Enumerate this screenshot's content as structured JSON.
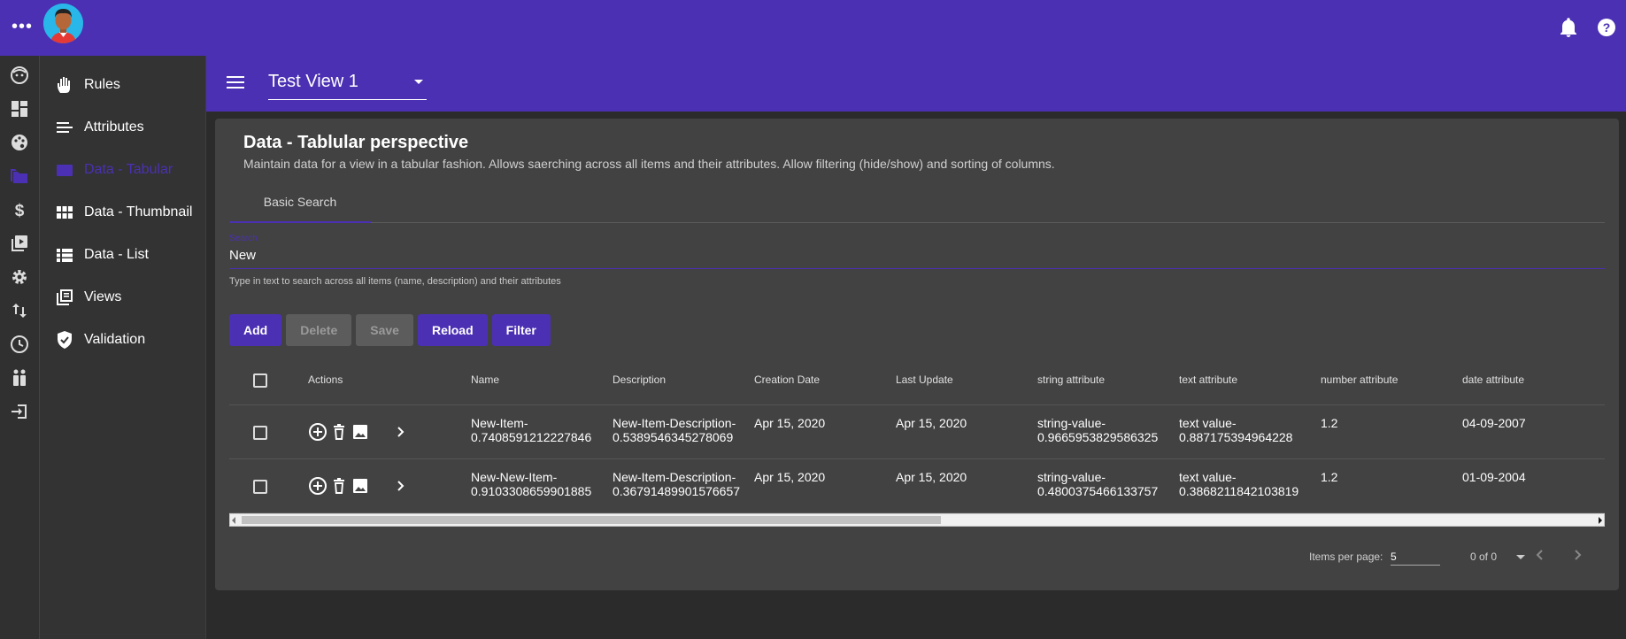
{
  "sidebar": {
    "items": [
      {
        "label": "Rules",
        "icon": "hand-icon"
      },
      {
        "label": "Attributes",
        "icon": "list-lines-icon"
      },
      {
        "label": "Data - Tabular",
        "icon": "table-icon",
        "active": true
      },
      {
        "label": "Data - Thumbnail",
        "icon": "grid-icon"
      },
      {
        "label": "Data - List",
        "icon": "list-icon"
      },
      {
        "label": "Views",
        "icon": "library-icon"
      },
      {
        "label": "Validation",
        "icon": "shield-check-icon"
      }
    ]
  },
  "view": {
    "selected": "Test View 1"
  },
  "card": {
    "title": "Data - Tablular perspective",
    "subtitle": "Maintain data for a view in a tabular fashion. Allows saerching across all items and their attributes. Allow filtering (hide/show) and sorting of columns."
  },
  "tabs": [
    "Basic Search"
  ],
  "search": {
    "label": "Search",
    "value": "New",
    "hint": "Type in text to search across all items (name, description) and their attributes"
  },
  "buttons": {
    "add": "Add",
    "delete": "Delete",
    "save": "Save",
    "reload": "Reload",
    "filter": "Filter"
  },
  "table": {
    "columns": {
      "actions": "Actions",
      "name": "Name",
      "description": "Description",
      "creation": "Creation Date",
      "update": "Last Update",
      "string_attr": "string attribute",
      "text_attr": "text attribute",
      "number_attr": "number attribute",
      "date_attr": "date attribute"
    },
    "rows": [
      {
        "name": [
          "New-Item-",
          "0.7408591212227846"
        ],
        "description": [
          "New-Item-Description-",
          "0.5389546345278069"
        ],
        "creation": "Apr 15, 2020",
        "update": "Apr 15, 2020",
        "string_attr": [
          "string-value-",
          "0.9665953829586325"
        ],
        "text_attr": [
          "text value-",
          "0.887175394964228"
        ],
        "number_attr": "1.2",
        "date_attr": "04-09-2007"
      },
      {
        "name": [
          "New-New-Item-",
          "0.9103308659901885"
        ],
        "description": [
          "New-Item-Description-",
          "0.36791489901576657"
        ],
        "creation": "Apr 15, 2020",
        "update": "Apr 15, 2020",
        "string_attr": [
          "string-value-",
          "0.4800375466133757"
        ],
        "text_attr": [
          "text value-",
          "0.3868211842103819"
        ],
        "number_attr": "1.2",
        "date_attr": "01-09-2004"
      }
    ]
  },
  "pagination": {
    "items_per_page_label": "Items per page:",
    "page_size": "5",
    "range": "0 of 0"
  },
  "colors": {
    "primary": "#4b30b3",
    "background": "#2b2b2b",
    "card": "#424242"
  }
}
